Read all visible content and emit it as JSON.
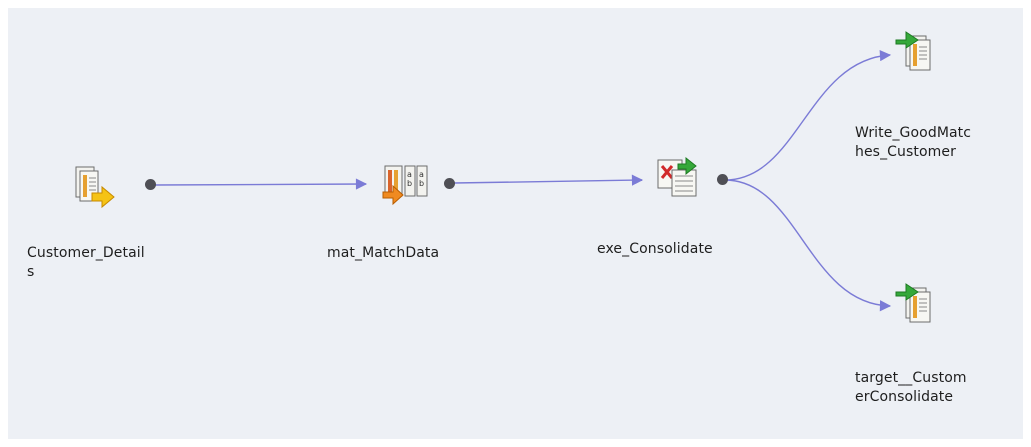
{
  "canvas": {
    "background": "#edf0f5",
    "wire_color": "#7b7bd6"
  },
  "nodes": {
    "customer_details": {
      "label": "Customer_Detail\ns",
      "kind": "read-data-object"
    },
    "mat_matchdata": {
      "label": "mat_MatchData",
      "kind": "match-transformation"
    },
    "exe_consolidate": {
      "label": "exe_Consolidate",
      "kind": "consolidation-transformation"
    },
    "write_goodmatches": {
      "label": "Write_GoodMatc\nhes_Customer",
      "kind": "write-data-object"
    },
    "target_consolidate": {
      "label": "target__Custom\nerConsolidate",
      "kind": "write-data-object"
    }
  }
}
